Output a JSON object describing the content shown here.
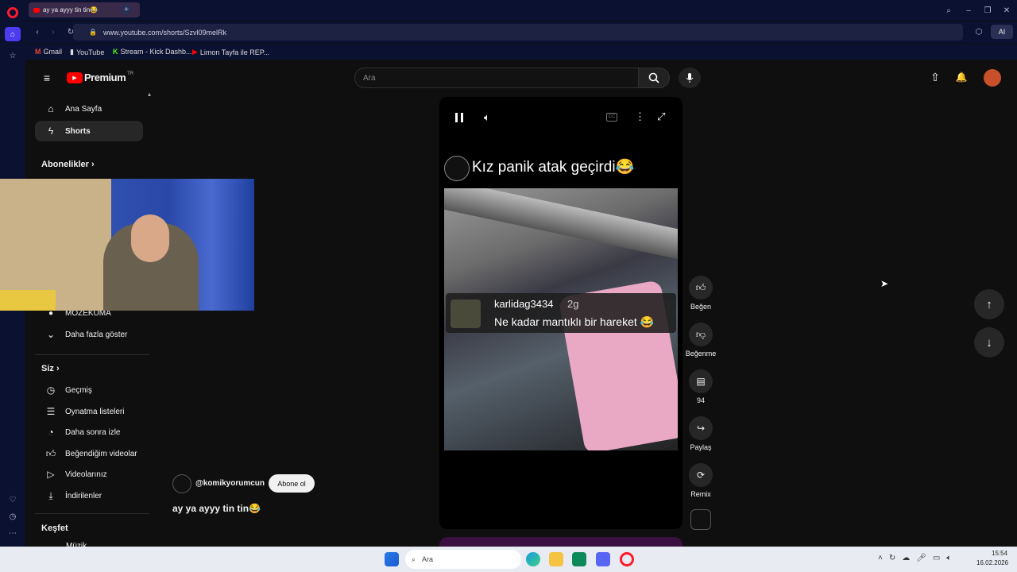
{
  "browser": {
    "tab_title": "ay ya ayyy tin tin😂",
    "url": "www.youtube.com/shorts/Szvl09melRk",
    "ai_label": "AI",
    "bookmarks": [
      {
        "label": "Gmail",
        "color": "#ea4335"
      },
      {
        "label": "YouTube",
        "color": "#ffffff"
      },
      {
        "label": "Stream - Kick Dashb...",
        "color": "#53fc18"
      },
      {
        "label": "Limon Tayfa ile REP...",
        "color": "#ff0000"
      }
    ]
  },
  "youtube": {
    "logo_text": "Premium",
    "logo_badge": "TR",
    "search_placeholder": "Ara",
    "sidebar": {
      "top_items": [
        {
          "label": "Ana Sayfa",
          "icon": "home-icon"
        },
        {
          "label": "Shorts",
          "icon": "shorts-icon"
        }
      ],
      "subscriptions_header": "Abonelikler",
      "channel_item": "MOZEKUMA",
      "show_more": "Daha fazla göster",
      "you_header": "Siz",
      "you_items": [
        {
          "label": "Geçmiş",
          "icon": "history-icon"
        },
        {
          "label": "Oynatma listeleri",
          "icon": "playlist-icon"
        },
        {
          "label": "Daha sonra izle",
          "icon": "clock-icon"
        },
        {
          "label": "Beğendiğim videolar",
          "icon": "like-icon"
        },
        {
          "label": "Videolarınız",
          "icon": "video-icon"
        },
        {
          "label": "İndirilenler",
          "icon": "download-icon"
        }
      ],
      "explore_header": "Keşfet",
      "explore_partial": "Müzik"
    },
    "short": {
      "overlay_title": "Kız panik atak geçirdi😂",
      "comment_user": "karlidag3434",
      "comment_age": "2g",
      "comment_text": "Ne kadar mantıklı bir hareket 😂",
      "channel": "@komikyorumcun",
      "subscribe_label": "Abone ol",
      "title": "ay ya ayyy tin tin😂"
    },
    "actions": {
      "like": "Beğen",
      "dislike": "Beğenme",
      "comments": "94",
      "share": "Paylaş",
      "remix": "Remix"
    },
    "accent": "#ff0000"
  },
  "taskbar": {
    "search_placeholder": "Ara",
    "time": "15:54",
    "date": "16.02.2026"
  }
}
